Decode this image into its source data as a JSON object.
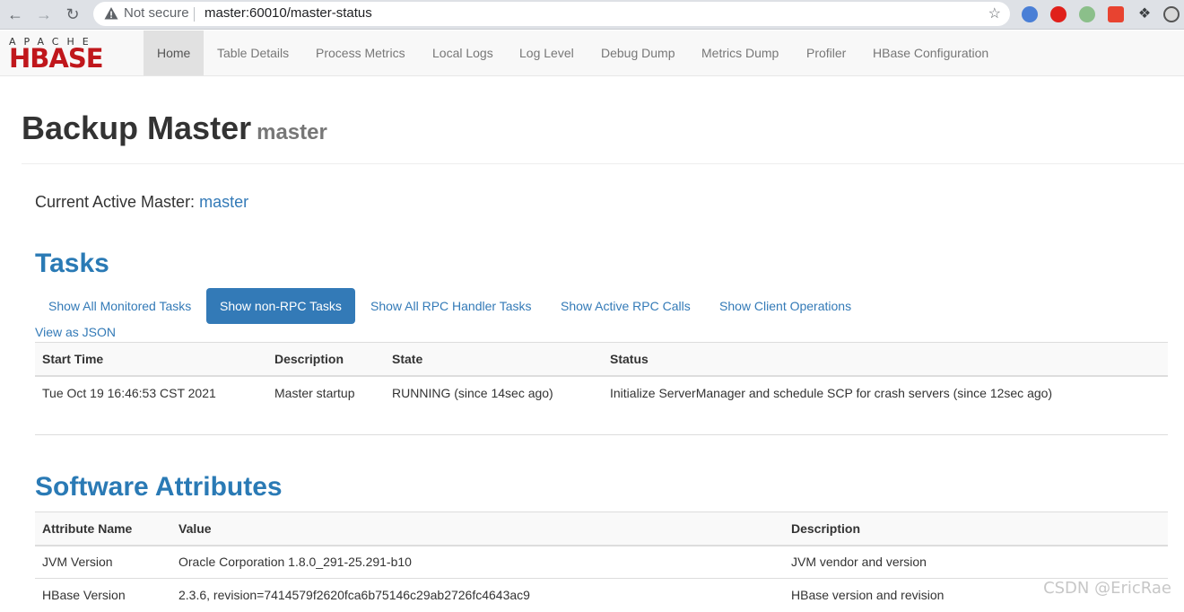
{
  "browser": {
    "security_label": "Not secure",
    "url": "master:60010/master-status"
  },
  "navbar": {
    "logo_top": "APACHE",
    "logo_main": "HBASE",
    "items": [
      {
        "label": "Home"
      },
      {
        "label": "Table Details"
      },
      {
        "label": "Process Metrics"
      },
      {
        "label": "Local Logs"
      },
      {
        "label": "Log Level"
      },
      {
        "label": "Debug Dump"
      },
      {
        "label": "Metrics Dump"
      },
      {
        "label": "Profiler"
      },
      {
        "label": "HBase Configuration"
      }
    ]
  },
  "page": {
    "title": "Backup Master",
    "subtitle": "master",
    "active_master_label": "Current Active Master:",
    "active_master_value": "master"
  },
  "tasks": {
    "heading": "Tasks",
    "tabs": [
      {
        "label": "Show All Monitored Tasks"
      },
      {
        "label": "Show non-RPC Tasks"
      },
      {
        "label": "Show All RPC Handler Tasks"
      },
      {
        "label": "Show Active RPC Calls"
      },
      {
        "label": "Show Client Operations"
      }
    ],
    "json_link": "View as JSON",
    "columns": [
      "Start Time",
      "Description",
      "State",
      "Status"
    ],
    "rows": [
      [
        "Tue Oct 19 16:46:53 CST 2021",
        "Master startup",
        "RUNNING (since 14sec ago)",
        "Initialize ServerManager and schedule SCP for crash servers (since 12sec ago)"
      ]
    ]
  },
  "software": {
    "heading": "Software Attributes",
    "columns": [
      "Attribute Name",
      "Value",
      "Description"
    ],
    "rows": [
      [
        "JVM Version",
        "Oracle Corporation 1.8.0_291-25.291-b10",
        "JVM vendor and version"
      ],
      [
        "HBase Version",
        "2.3.6, revision=7414579f2620fca6b75146c29ab2726fc4643ac9",
        "HBase version and revision"
      ]
    ]
  },
  "watermark": "CSDN @EricRae",
  "colors": {
    "accent": "#337ab7",
    "heading": "#2a7ab5",
    "logo_red": "#c0171c"
  }
}
